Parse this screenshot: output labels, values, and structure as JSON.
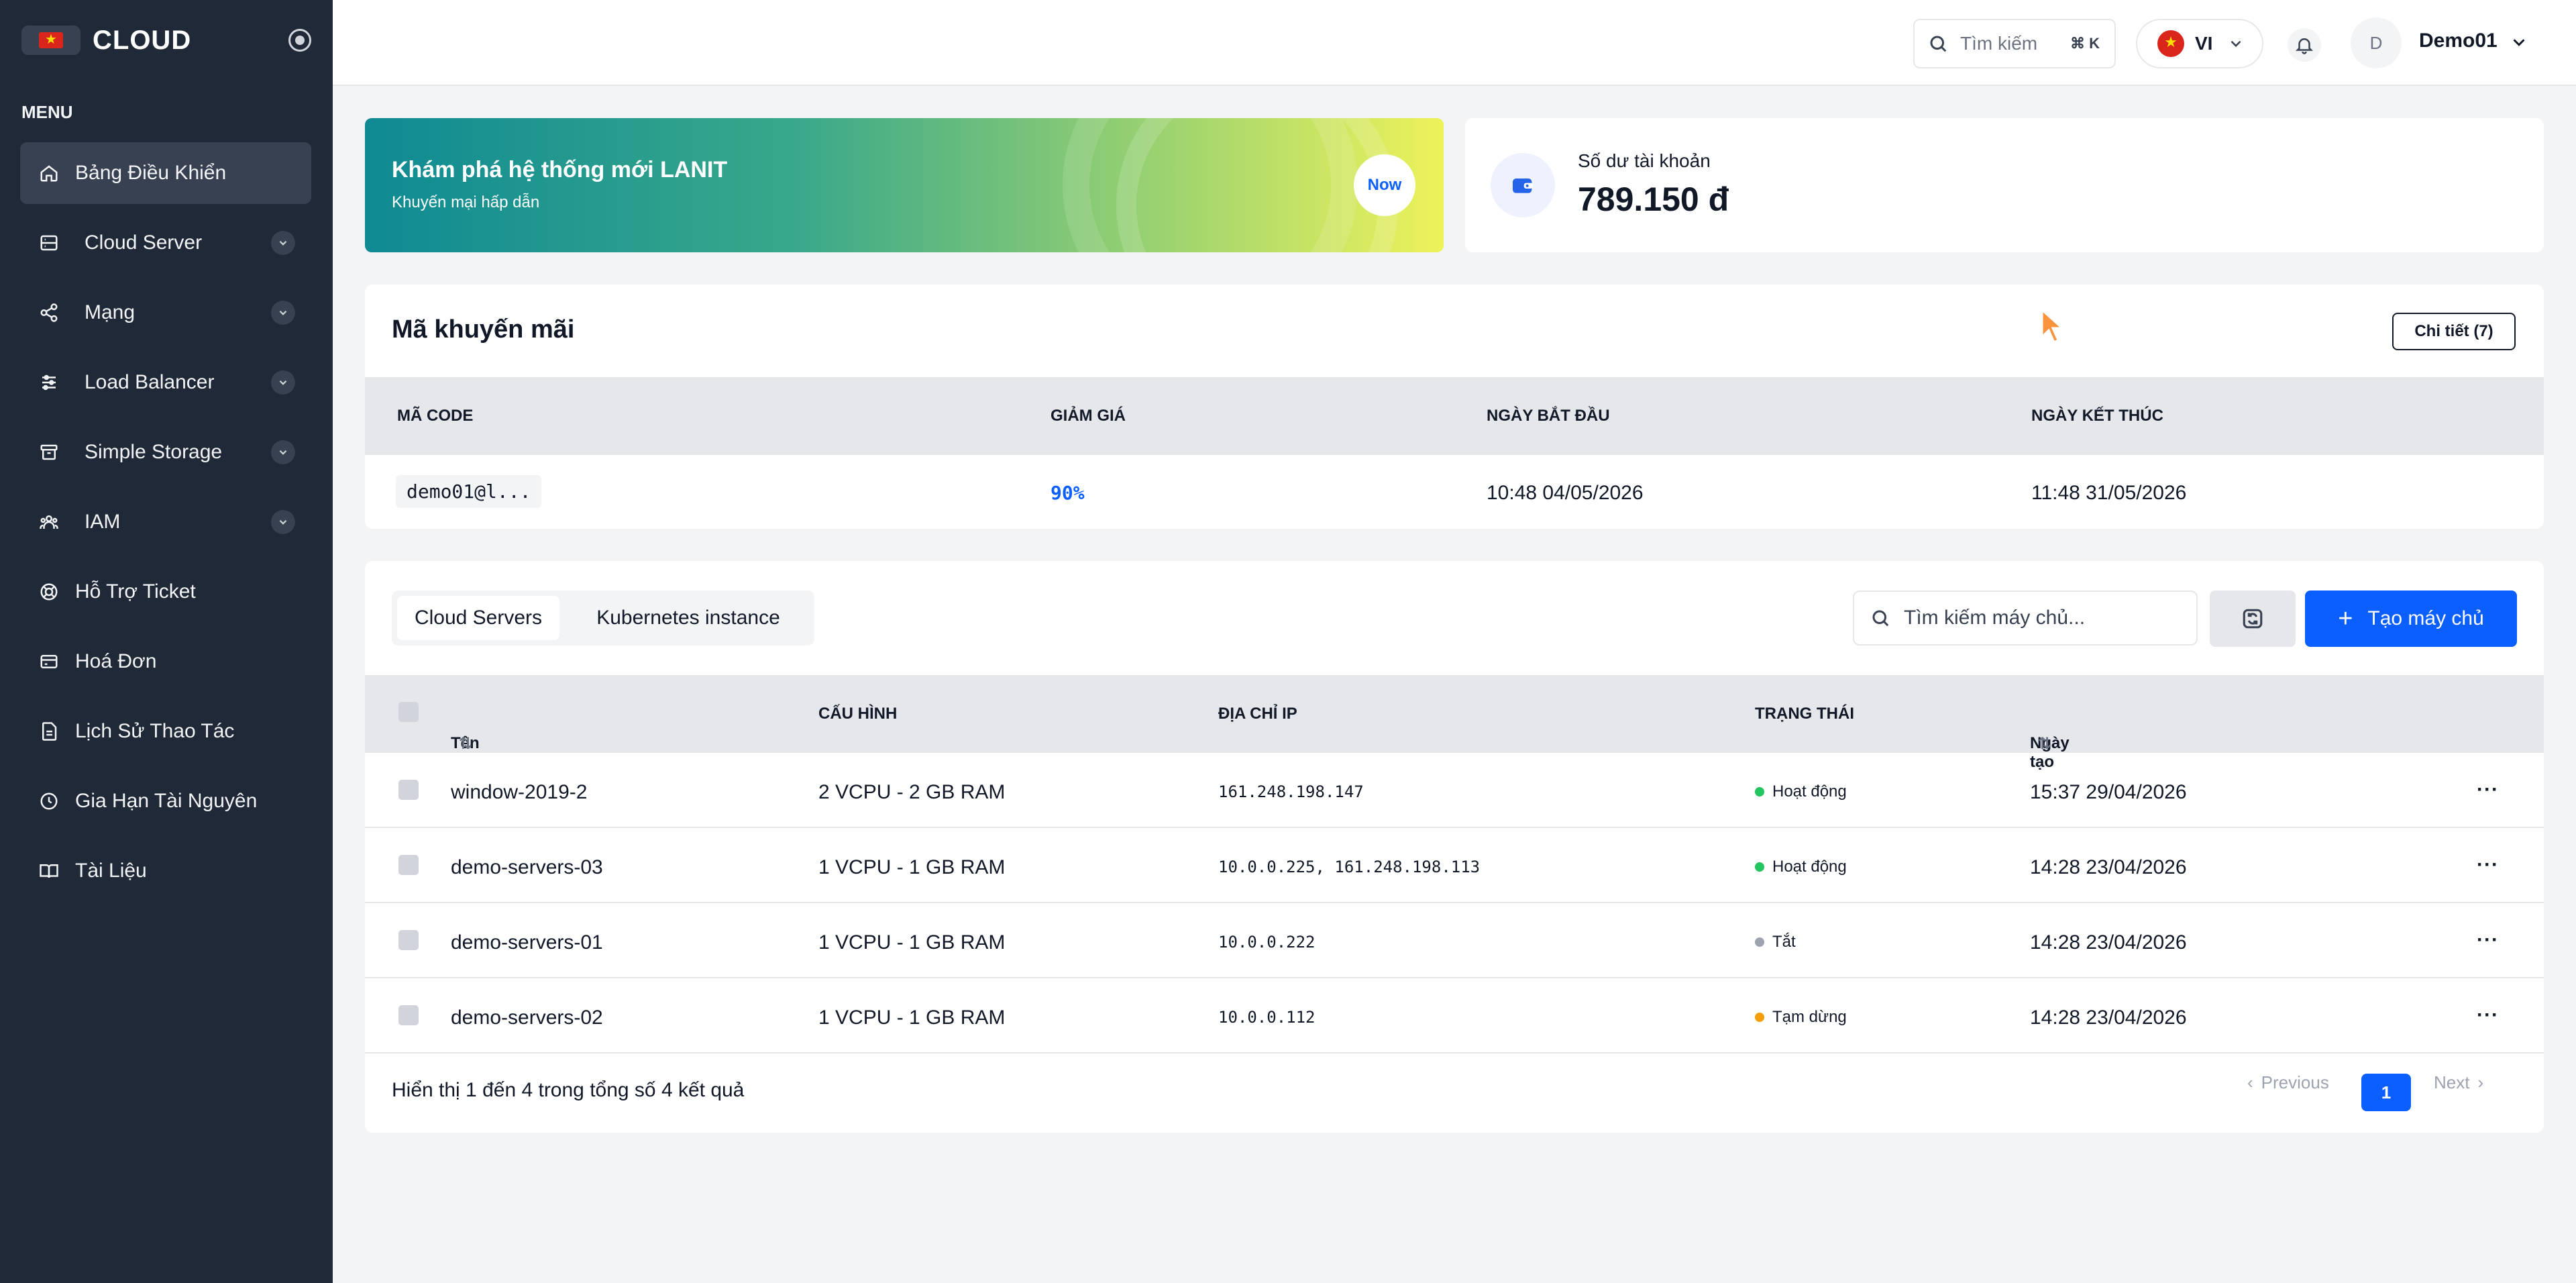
{
  "brand": {
    "name": "CLOUD"
  },
  "sidebar": {
    "menu_label": "MENU",
    "items": [
      {
        "label": "Bảng Điều Khiển",
        "icon": "home-icon",
        "active": true,
        "has_sub": false
      },
      {
        "label": "Cloud Server",
        "icon": "server-icon",
        "has_sub": true
      },
      {
        "label": "Mạng",
        "icon": "share-icon",
        "has_sub": true
      },
      {
        "label": "Load Balancer",
        "icon": "sliders-icon",
        "has_sub": true
      },
      {
        "label": "Simple Storage",
        "icon": "archive-icon",
        "has_sub": true
      },
      {
        "label": "IAM",
        "icon": "users-icon",
        "has_sub": true
      },
      {
        "label": "Hỗ Trợ Ticket",
        "icon": "lifebuoy-icon",
        "has_sub": false
      },
      {
        "label": "Hoá Đơn",
        "icon": "credit-card-icon",
        "has_sub": false
      },
      {
        "label": "Lịch Sử Thao Tác",
        "icon": "file-icon",
        "has_sub": false
      },
      {
        "label": "Gia Hạn Tài Nguyên",
        "icon": "clock-icon",
        "has_sub": false
      },
      {
        "label": "Tài Liệu",
        "icon": "book-icon",
        "has_sub": false
      }
    ]
  },
  "topbar": {
    "search_placeholder": "Tìm kiếm",
    "search_shortcut": "⌘ K",
    "language": "VI",
    "user_initial": "D",
    "username": "Demo01"
  },
  "banner": {
    "title": "Khám phá hệ thống mới LANIT",
    "subtitle": "Khuyến mại hấp dẫn",
    "button": "Now"
  },
  "balance": {
    "label": "Số dư tài khoản",
    "value": "789.150 đ"
  },
  "promo": {
    "title": "Mã khuyến mãi",
    "detail_button": "Chi tiết (7)",
    "columns": [
      "MÃ CODE",
      "GIẢM GIÁ",
      "NGÀY BẮT ĐẦU",
      "NGÀY KẾT THÚC"
    ],
    "rows": [
      {
        "code": "demo01@l...",
        "discount": "90%",
        "start": "10:48 04/05/2026",
        "end": "11:48 31/05/2026"
      }
    ]
  },
  "servers": {
    "tabs": [
      "Cloud Servers",
      "Kubernetes instance"
    ],
    "search_placeholder": "Tìm kiếm máy chủ...",
    "create_button": "Tạo máy chủ",
    "columns": [
      "Tên",
      "CẤU HÌNH",
      "ĐỊA CHỈ IP",
      "TRẠNG THÁI",
      "Ngày tạo"
    ],
    "rows": [
      {
        "name": "window-2019-2",
        "config": "2 VCPU - 2 GB RAM",
        "ip": "161.248.198.147",
        "status": "Hoạt động",
        "status_color": "#22c55e",
        "created": "15:37 29/04/2026"
      },
      {
        "name": "demo-servers-03",
        "config": "1 VCPU - 1 GB RAM",
        "ip": "10.0.0.225, 161.248.198.113",
        "status": "Hoạt động",
        "status_color": "#22c55e",
        "created": "14:28 23/04/2026"
      },
      {
        "name": "demo-servers-01",
        "config": "1 VCPU - 1 GB RAM",
        "ip": "10.0.0.222",
        "status": "Tắt",
        "status_color": "#9ca3af",
        "created": "14:28 23/04/2026"
      },
      {
        "name": "demo-servers-02",
        "config": "1 VCPU - 1 GB RAM",
        "ip": "10.0.0.112",
        "status": "Tạm dừng",
        "status_color": "#f59e0b",
        "created": "14:28 23/04/2026"
      }
    ],
    "footer_text": "Hiển thị 1 đến 4 trong tổng số 4 kết quả",
    "pagination": {
      "previous": "Previous",
      "current": "1",
      "next": "Next"
    }
  },
  "colors": {
    "accent": "#0b5fff",
    "sidebar_bg": "#1f2937"
  }
}
